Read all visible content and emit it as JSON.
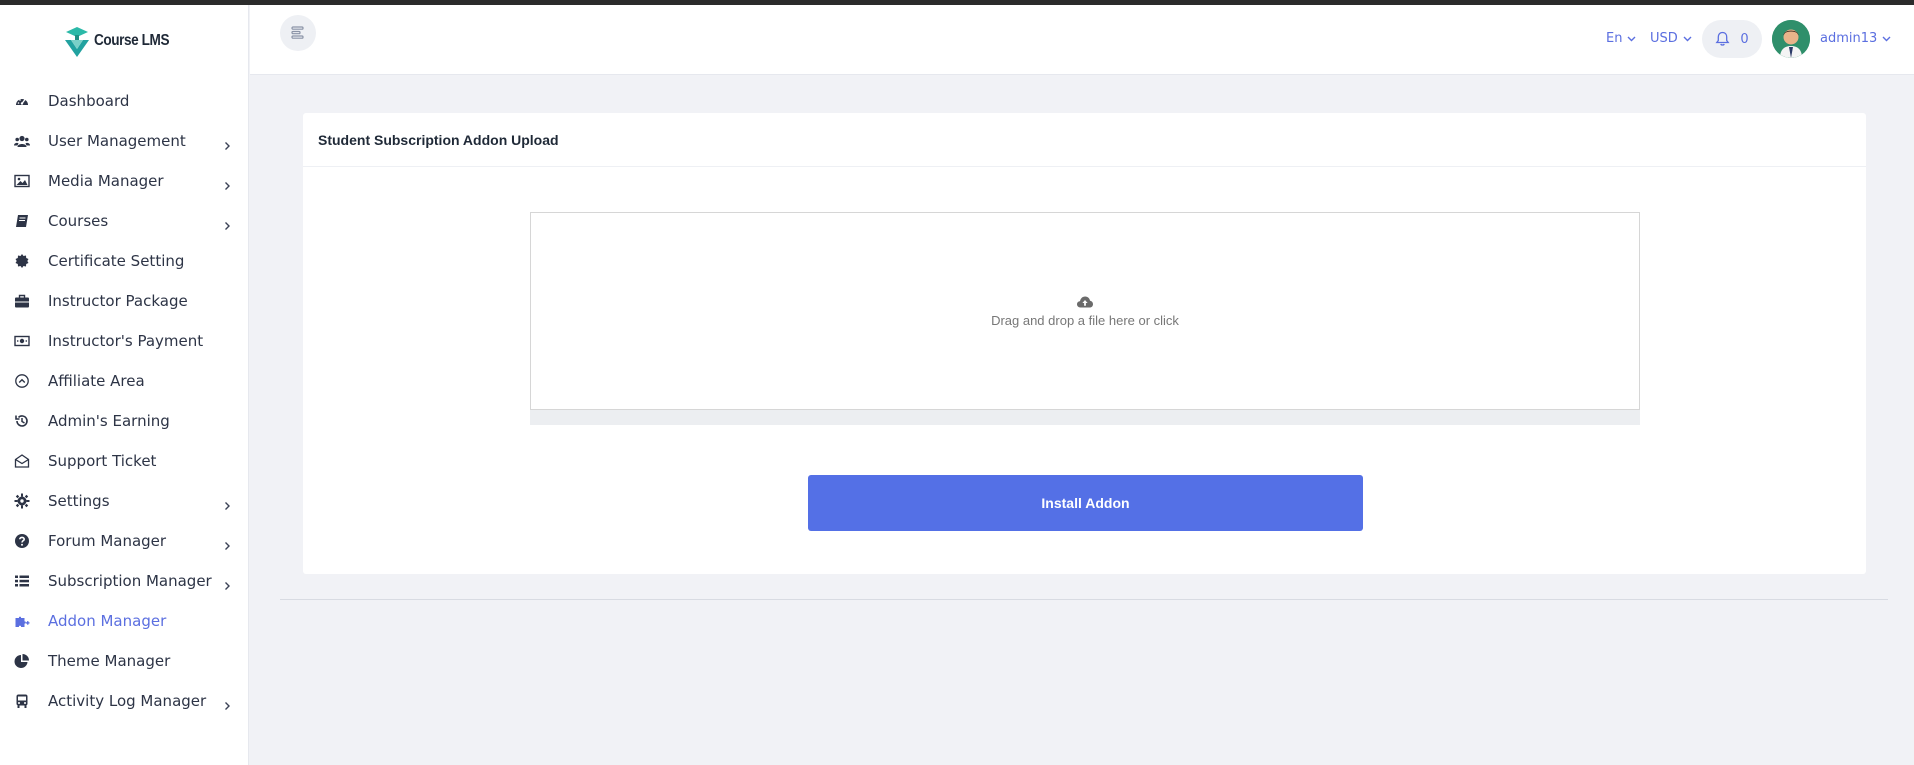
{
  "brand": {
    "name": "Course LMS"
  },
  "sidebar": {
    "items": [
      {
        "label": "Dashboard",
        "icon": "tachometer-icon",
        "has_children": false,
        "active": false
      },
      {
        "label": "User Management",
        "icon": "users-icon",
        "has_children": true,
        "active": false
      },
      {
        "label": "Media Manager",
        "icon": "image-icon",
        "has_children": true,
        "active": false
      },
      {
        "label": "Courses",
        "icon": "book-icon",
        "has_children": true,
        "active": false
      },
      {
        "label": "Certificate Setting",
        "icon": "certificate-icon",
        "has_children": false,
        "active": false
      },
      {
        "label": "Instructor Package",
        "icon": "briefcase-icon",
        "has_children": false,
        "active": false
      },
      {
        "label": "Instructor's Payment",
        "icon": "money-bill-icon",
        "has_children": false,
        "active": false
      },
      {
        "label": "Affiliate Area",
        "icon": "chevron-circle-up-icon",
        "has_children": false,
        "active": false
      },
      {
        "label": "Admin's Earning",
        "icon": "history-icon",
        "has_children": false,
        "active": false
      },
      {
        "label": "Support Ticket",
        "icon": "envelope-open-icon",
        "has_children": false,
        "active": false
      },
      {
        "label": "Settings",
        "icon": "gear-icon",
        "has_children": true,
        "active": false
      },
      {
        "label": "Forum Manager",
        "icon": "question-circle-icon",
        "has_children": true,
        "active": false
      },
      {
        "label": "Subscription Manager",
        "icon": "list-icon",
        "has_children": true,
        "active": false
      },
      {
        "label": "Addon Manager",
        "icon": "puzzle-piece-icon",
        "has_children": false,
        "active": true
      },
      {
        "label": "Theme Manager",
        "icon": "pie-chart-icon",
        "has_children": false,
        "active": false
      },
      {
        "label": "Activity Log Manager",
        "icon": "bus-icon",
        "has_children": true,
        "active": false
      }
    ]
  },
  "topbar": {
    "language": "En",
    "currency": "USD",
    "notification_count": "0",
    "username": "admin13"
  },
  "main": {
    "card_title": "Student Subscription Addon Upload",
    "dropzone_text": "Drag and drop a file here or click",
    "install_button": "Install Addon"
  },
  "colors": {
    "accent": "#5470e6",
    "link": "#5b6fe0",
    "background": "#f1f2f6"
  }
}
